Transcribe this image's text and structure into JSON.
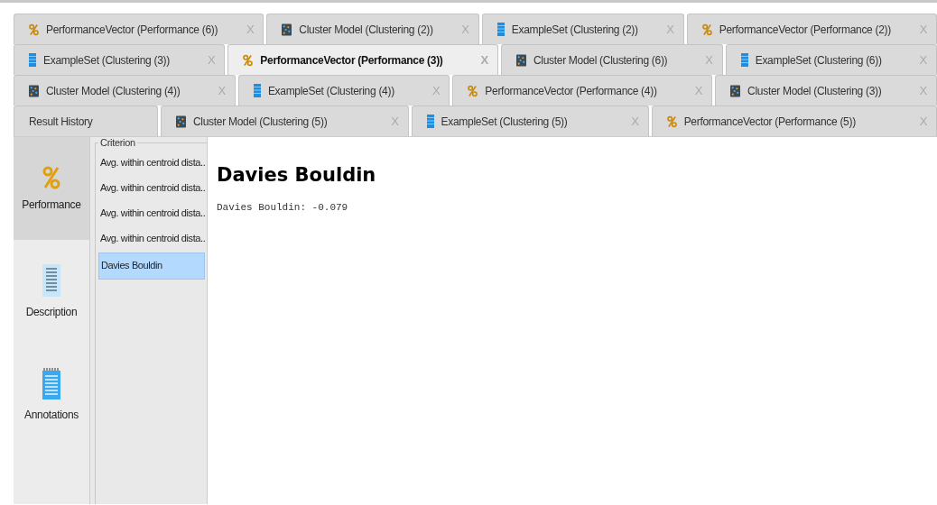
{
  "tab_rows": [
    [
      {
        "kind": "performance",
        "label": "PerformanceVector (Performance (6))",
        "close": "X",
        "selected": false
      },
      {
        "kind": "cluster",
        "label": "Cluster Model (Clustering (2))",
        "close": "X",
        "selected": false
      },
      {
        "kind": "exampleset",
        "label": "ExampleSet (Clustering (2))",
        "close": "X",
        "selected": false
      },
      {
        "kind": "performance",
        "label": "PerformanceVector (Performance (2))",
        "close": "X",
        "selected": false
      }
    ],
    [
      {
        "kind": "exampleset",
        "label": "ExampleSet (Clustering (3))",
        "close": "X",
        "selected": false
      },
      {
        "kind": "performance",
        "label": "PerformanceVector (Performance (3))",
        "close": "X",
        "selected": true
      },
      {
        "kind": "cluster",
        "label": "Cluster Model (Clustering (6))",
        "close": "X",
        "selected": false
      },
      {
        "kind": "exampleset",
        "label": "ExampleSet (Clustering (6))",
        "close": "X",
        "selected": false
      }
    ],
    [
      {
        "kind": "cluster",
        "label": "Cluster Model (Clustering (4))",
        "close": "X",
        "selected": false
      },
      {
        "kind": "exampleset",
        "label": "ExampleSet (Clustering (4))",
        "close": "X",
        "selected": false
      },
      {
        "kind": "performance",
        "label": "PerformanceVector (Performance (4))",
        "close": "X",
        "selected": false
      },
      {
        "kind": "cluster",
        "label": "Cluster Model (Clustering (3))",
        "close": "X",
        "selected": false
      }
    ],
    [
      {
        "kind": "history",
        "label": "Result History",
        "selected": false
      },
      {
        "kind": "cluster",
        "label": "Cluster Model (Clustering (5))",
        "close": "X",
        "selected": false
      },
      {
        "kind": "exampleset",
        "label": "ExampleSet (Clustering (5))",
        "close": "X",
        "selected": false
      },
      {
        "kind": "performance",
        "label": "PerformanceVector (Performance (5))",
        "close": "X",
        "selected": false
      }
    ]
  ],
  "views": [
    {
      "kind": "performance",
      "label": "Performance",
      "selected": true
    },
    {
      "kind": "description",
      "label": "Description",
      "selected": false
    },
    {
      "kind": "annotations",
      "label": "Annotations",
      "selected": false
    }
  ],
  "criterion": {
    "title": "Criterion",
    "items": [
      {
        "label": "Avg. within centroid dista..",
        "selected": false
      },
      {
        "label": "Avg. within centroid dista..",
        "selected": false
      },
      {
        "label": "Avg. within centroid dista..",
        "selected": false
      },
      {
        "label": "Avg. within centroid dista..",
        "selected": false
      },
      {
        "label": "Davies Bouldin",
        "selected": true
      }
    ]
  },
  "detail": {
    "title": "Davies Bouldin",
    "text": "Davies Bouldin: -0.079"
  }
}
